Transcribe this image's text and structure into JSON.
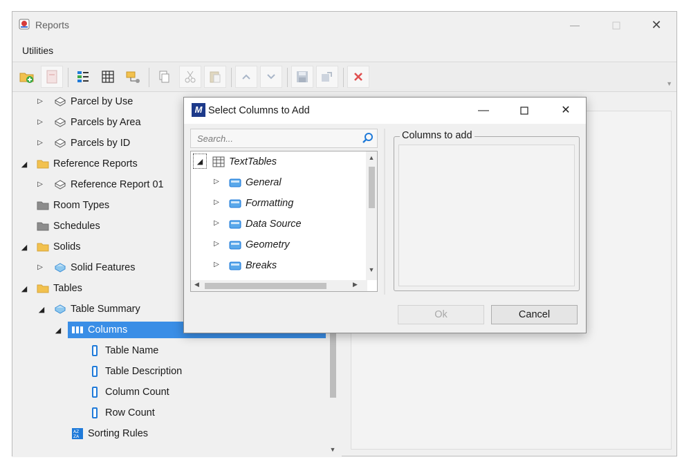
{
  "window": {
    "title": "Reports",
    "menu": [
      "Utilities"
    ]
  },
  "toolbar": {
    "buttons": [
      {
        "name": "add-folder",
        "icon": "folder-add-icon"
      },
      {
        "name": "new-report",
        "icon": "report-icon"
      },
      {
        "name": "report-list",
        "icon": "list-icon"
      },
      {
        "name": "table",
        "icon": "table-icon"
      },
      {
        "name": "properties",
        "icon": "properties-icon"
      },
      {
        "name": "copy",
        "icon": "copy-icon"
      },
      {
        "name": "cut",
        "icon": "scissors-icon"
      },
      {
        "name": "paste",
        "icon": "paste-icon"
      },
      {
        "name": "move-up",
        "icon": "chevron-up-icon"
      },
      {
        "name": "move-down",
        "icon": "chevron-down-icon"
      },
      {
        "name": "save",
        "icon": "save-icon"
      },
      {
        "name": "export",
        "icon": "export-icon"
      },
      {
        "name": "delete",
        "icon": "delete-icon"
      }
    ]
  },
  "tree": {
    "items": [
      {
        "label": "Parcel by Use",
        "icon": "report-icon"
      },
      {
        "label": "Parcels by Area",
        "icon": "report-icon"
      },
      {
        "label": "Parcels by ID",
        "icon": "report-icon"
      },
      {
        "label": "Reference Reports",
        "icon": "folder-icon"
      },
      {
        "label": "Reference Report 01",
        "icon": "report-icon"
      },
      {
        "label": "Room Types",
        "icon": "folder-icon"
      },
      {
        "label": "Schedules",
        "icon": "folder-icon"
      },
      {
        "label": "Solids",
        "icon": "folder-icon"
      },
      {
        "label": "Solid Features",
        "icon": "report-icon"
      },
      {
        "label": "Tables",
        "icon": "folder-icon"
      },
      {
        "label": "Table Summary",
        "icon": "report-icon"
      },
      {
        "label": "Columns",
        "icon": "columns-icon"
      },
      {
        "label": "Table Name",
        "icon": "column-icon"
      },
      {
        "label": "Table Description",
        "icon": "column-icon"
      },
      {
        "label": "Column Count",
        "icon": "column-icon"
      },
      {
        "label": "Row Count",
        "icon": "column-icon"
      },
      {
        "label": "Sorting Rules",
        "icon": "sort-icon"
      }
    ]
  },
  "dialog": {
    "title": "Select Columns to Add",
    "search_placeholder": "Search...",
    "tree": [
      {
        "label": "TextTables"
      },
      {
        "label": "General"
      },
      {
        "label": "Formatting"
      },
      {
        "label": "Data Source"
      },
      {
        "label": "Geometry"
      },
      {
        "label": "Breaks"
      }
    ],
    "columns_group_label": "Columns to add",
    "ok_label": "Ok",
    "cancel_label": "Cancel"
  },
  "colors": {
    "selection": "#3a8ee6",
    "folder": "#f2c14e",
    "accent_blue": "#1f7ad9",
    "delete_red": "#e05050"
  }
}
